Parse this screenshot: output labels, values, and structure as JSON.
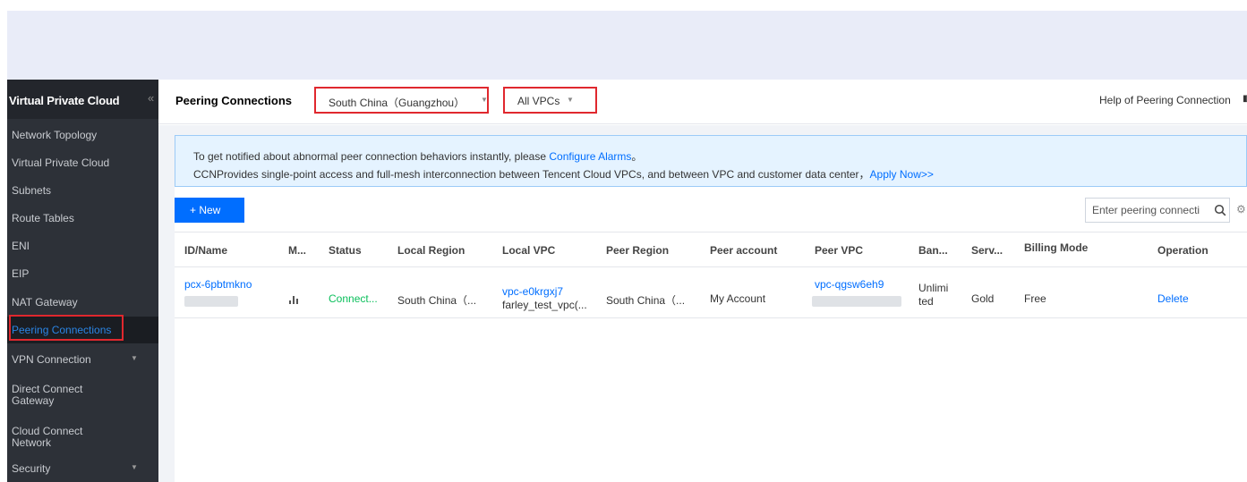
{
  "sidebar": {
    "title": "Virtual Private Cloud",
    "collapse_glyph": "«",
    "items": [
      {
        "label": "Network Topology"
      },
      {
        "label": "Virtual Private Cloud"
      },
      {
        "label": "Subnets"
      },
      {
        "label": "Route Tables"
      },
      {
        "label": "ENI"
      },
      {
        "label": "EIP"
      },
      {
        "label": "NAT Gateway"
      },
      {
        "label": "Peering Connections",
        "active": true
      },
      {
        "label": "VPN Connection",
        "has_submenu": true
      },
      {
        "label_line1": "Direct Connect",
        "label_line2": "Gateway"
      },
      {
        "label_line1": "Cloud Connect",
        "label_line2": "Network"
      },
      {
        "label": "Security",
        "has_submenu": true
      }
    ]
  },
  "header": {
    "title": "Peering Connections",
    "region_select": {
      "value": "South China（Guangzhou）"
    },
    "vpc_select": {
      "value": "All VPCs"
    },
    "help_link": "Help of Peering Connection"
  },
  "notice": {
    "line1_text": "To get notified about abnormal peer connection behaviors instantly, please ",
    "line1_link": "Configure Alarms",
    "line1_end": "。",
    "line2_text": "CCNProvides single-point access and full-mesh interconnection between Tencent Cloud VPCs, and between VPC and customer data center，",
    "line2_link": "Apply Now>>"
  },
  "toolbar": {
    "new_label": "+ New",
    "search_placeholder": "Enter peering connecti"
  },
  "table": {
    "columns": [
      "ID/Name",
      "M...",
      "Status",
      "Local Region",
      "Local VPC",
      "Peer Region",
      "Peer account",
      "Peer VPC",
      "Ban...",
      "Serv...",
      "Billing Mode",
      "Operation"
    ],
    "rows": [
      {
        "id": "pcx-6pbtmkno",
        "status": "Connect...",
        "local_region": "South China（...",
        "local_vpc_id": "vpc-e0krgxj7",
        "local_vpc_name": "farley_test_vpc(...",
        "peer_region": "South China（...",
        "peer_account": "My Account",
        "peer_vpc_id": "vpc-qgsw6eh9",
        "bandwidth_line1": "Unlimi",
        "bandwidth_line2": "ted",
        "service": "Gold",
        "billing_mode": "Free",
        "operation": "Delete"
      }
    ]
  },
  "colors": {
    "accent": "#006eff",
    "highlight_border": "#e0282e",
    "status_ok": "#0abf5b",
    "sidebar_bg": "#2d3138"
  },
  "icons": [
    "collapse-icon",
    "chevron-down-icon",
    "search-icon",
    "settings-icon",
    "monitor-chart-icon",
    "help-icon"
  ]
}
